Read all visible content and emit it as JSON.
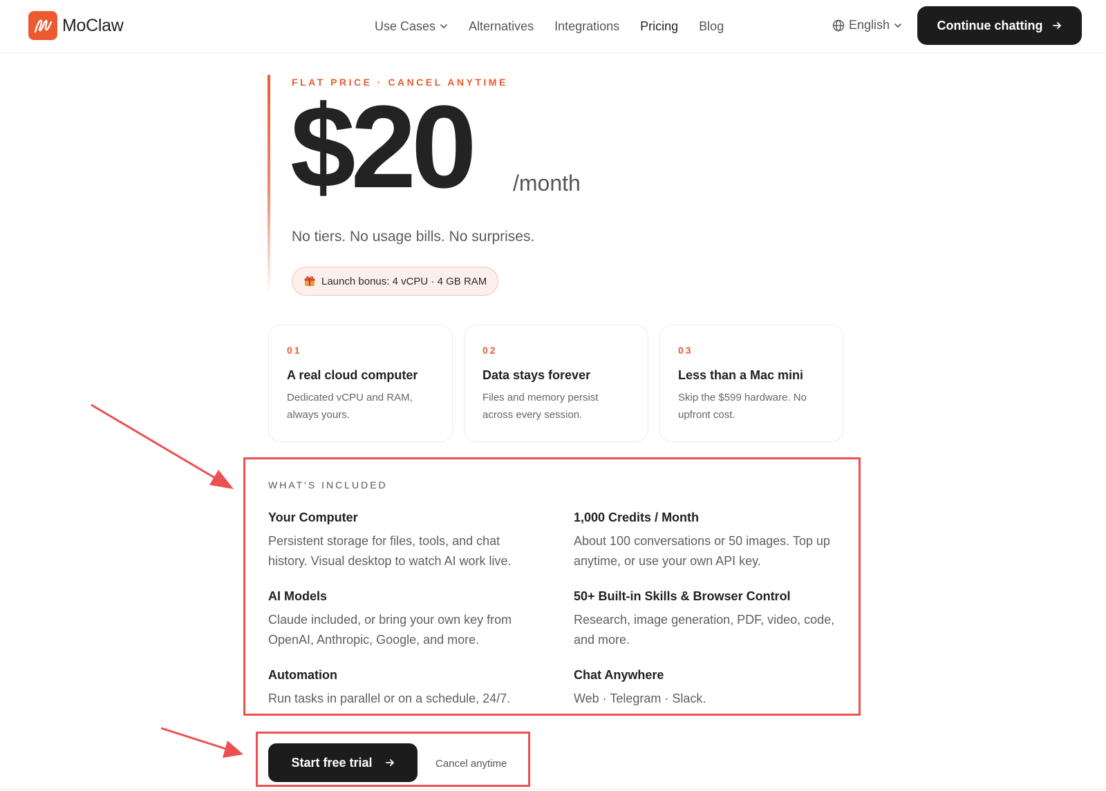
{
  "header": {
    "brand": "MoClaw",
    "nav": [
      {
        "label": "Use Cases",
        "has_dropdown": true
      },
      {
        "label": "Alternatives"
      },
      {
        "label": "Integrations"
      },
      {
        "label": "Pricing",
        "active": true
      },
      {
        "label": "Blog"
      }
    ],
    "language": "English",
    "cta": "Continue chatting"
  },
  "pricing": {
    "eyebrow": "FLAT PRICE · CANCEL ANYTIME",
    "price": "$20",
    "period": "/month",
    "tagline": "No tiers. No usage bills. No surprises.",
    "bonus": "Launch bonus: 4 vCPU · 4 GB RAM",
    "bonus_icon": "gift-icon"
  },
  "features": [
    {
      "num": "01",
      "title": "A real cloud computer",
      "desc": "Dedicated vCPU and RAM, always yours."
    },
    {
      "num": "02",
      "title": "Data stays forever",
      "desc": "Files and memory persist across every session."
    },
    {
      "num": "03",
      "title": "Less than a Mac mini",
      "desc": "Skip the $599 hardware. No upfront cost."
    }
  ],
  "included": {
    "label": "WHAT'S INCLUDED",
    "items": [
      {
        "title": "Your Computer",
        "desc": "Persistent storage for files, tools, and chat history. Visual desktop to watch AI work live."
      },
      {
        "title": "1,000 Credits / Month",
        "desc": "About 100 conversations or 50 images. Top up anytime, or use your own API key."
      },
      {
        "title": "AI Models",
        "desc": "Claude included, or bring your own key from OpenAI, Anthropic, Google, and more."
      },
      {
        "title": "50+ Built-in Skills & Browser Control",
        "desc": "Research, image generation, PDF, video, code, and more."
      },
      {
        "title": "Automation",
        "desc": "Run tasks in parallel or on a schedule, 24/7."
      },
      {
        "title": "Chat Anywhere",
        "desc": "Web · Telegram · Slack."
      }
    ]
  },
  "bottom_cta": {
    "button": "Start free trial",
    "note": "Cancel anytime"
  },
  "colors": {
    "accent": "#ec5a32",
    "annotation": "#ec5050",
    "dark": "#1c1c1c"
  }
}
